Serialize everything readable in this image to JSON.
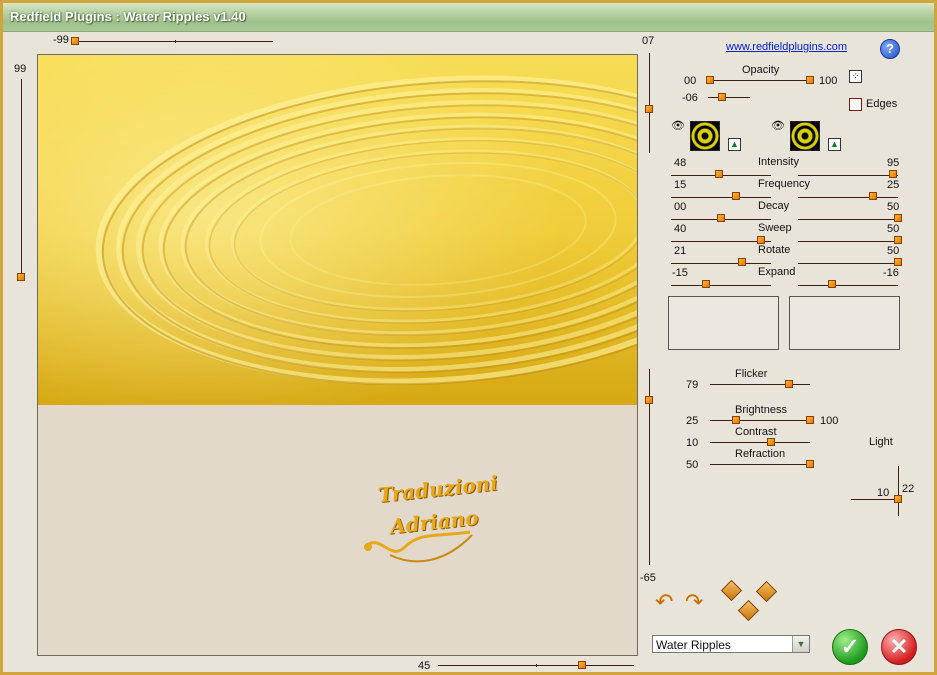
{
  "window": {
    "title": "Redfield Plugins : Water Ripples v1.40"
  },
  "link": "www.redfieldplugins.com",
  "help": "?",
  "preview": {
    "top_slider_value": "-99",
    "left_slider_value": "99",
    "bottom_slider_value": "45",
    "right_slider_top_value": "07",
    "right_slider_bottom_value": "-65",
    "watermark_line1": "Traduzioni",
    "watermark_line2": "Adriano"
  },
  "opacity": {
    "label": "Opacity",
    "min": "00",
    "max": "100",
    "offset": "-06"
  },
  "edges": {
    "label": "Edges"
  },
  "sliders": [
    {
      "label": "Intensity",
      "left": "48",
      "right": "95"
    },
    {
      "label": "Frequency",
      "left": "15",
      "right": "25"
    },
    {
      "label": "Decay",
      "left": "00",
      "right": "50"
    },
    {
      "label": "Sweep",
      "left": "40",
      "right": "50"
    },
    {
      "label": "Rotate",
      "left": "21",
      "right": "50"
    },
    {
      "label": "Expand",
      "left": "-15",
      "right": "-16"
    }
  ],
  "lighting": {
    "flicker": {
      "label": "Flicker",
      "value": "79"
    },
    "brightness": {
      "label": "Brightness",
      "value": "25",
      "max": "100"
    },
    "contrast": {
      "label": "Contrast",
      "value": "10"
    },
    "refraction": {
      "label": "Refraction",
      "value": "50"
    },
    "light": {
      "label": "Light",
      "x": "10",
      "y": "22"
    }
  },
  "effect_select": {
    "value": "Water Ripples"
  },
  "colors": {
    "accent": "#e07a00",
    "title_bar": "#a9c896",
    "ok": "#1d9a1d",
    "cancel": "#d51d1d"
  }
}
